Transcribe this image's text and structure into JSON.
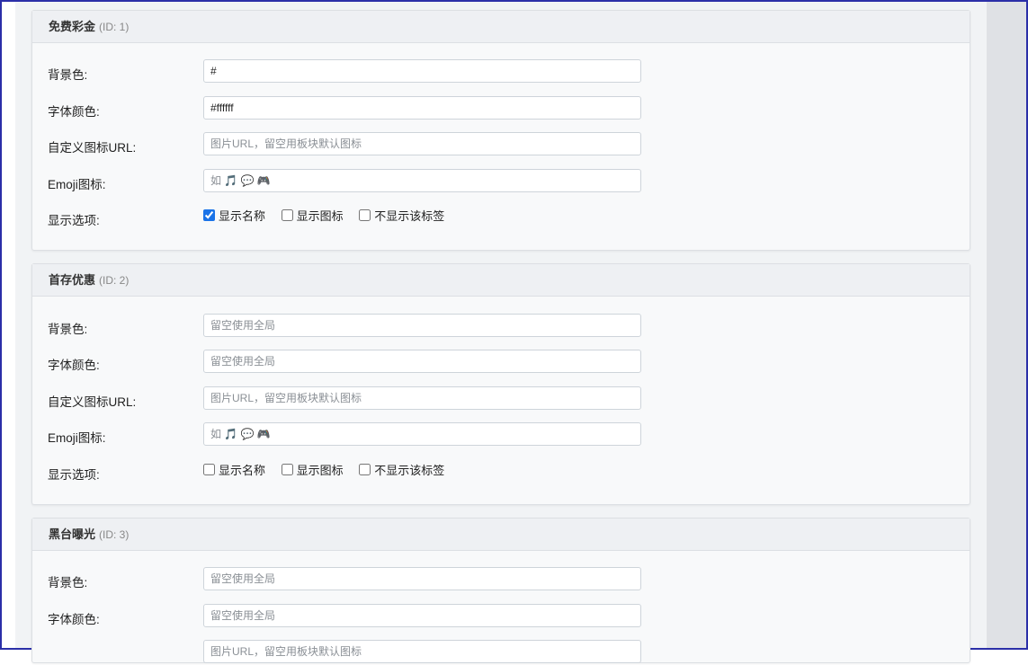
{
  "panels": [
    {
      "title": "免费彩金",
      "id_label": "(ID: 1)",
      "bg_label": "背景色:",
      "bg_value": "#",
      "bg_placeholder": "",
      "font_label": "字体颜色:",
      "font_value": "#ffffff",
      "font_placeholder": "",
      "icon_label": "自定义图标URL:",
      "icon_placeholder": "图片URL，留空用板块默认图标",
      "emoji_label": "Emoji图标:",
      "emoji_placeholder": "如 🎵 💬 🎮",
      "options_label": "显示选项:",
      "opt_name": "显示名称",
      "opt_icon": "显示图标",
      "opt_hide": "不显示该标签",
      "opt_name_checked": true,
      "opt_icon_checked": false,
      "opt_hide_checked": false
    },
    {
      "title": "首存优惠",
      "id_label": "(ID: 2)",
      "bg_label": "背景色:",
      "bg_value": "",
      "bg_placeholder": "留空使用全局",
      "font_label": "字体颜色:",
      "font_value": "",
      "font_placeholder": "留空使用全局",
      "icon_label": "自定义图标URL:",
      "icon_placeholder": "图片URL，留空用板块默认图标",
      "emoji_label": "Emoji图标:",
      "emoji_placeholder": "如 🎵 💬 🎮",
      "options_label": "显示选项:",
      "opt_name": "显示名称",
      "opt_icon": "显示图标",
      "opt_hide": "不显示该标签",
      "opt_name_checked": false,
      "opt_icon_checked": false,
      "opt_hide_checked": false
    },
    {
      "title": "黑台曝光",
      "id_label": "(ID: 3)",
      "bg_label": "背景色:",
      "bg_value": "",
      "bg_placeholder": "留空使用全局",
      "font_label": "字体颜色:",
      "font_value": "",
      "font_placeholder": "留空使用全局",
      "icon_label": "",
      "icon_placeholder": "图片URL，留空用板块默认图标"
    }
  ],
  "colors": {
    "accent": "#1a73e8",
    "panel_bg": "#f8f9fa",
    "header_bg": "#eef0f3"
  }
}
